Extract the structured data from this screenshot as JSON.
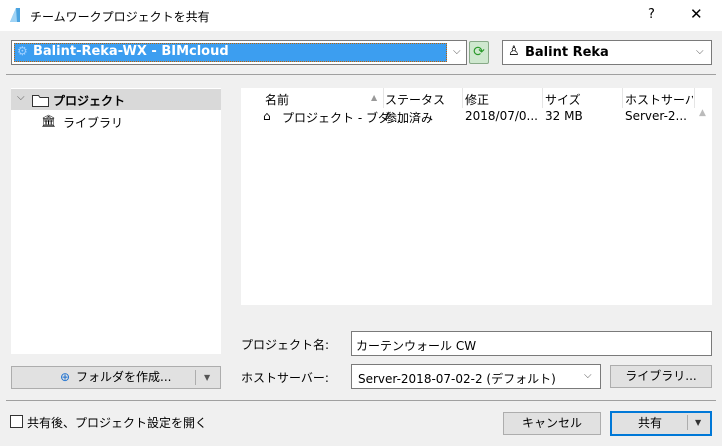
{
  "window": {
    "title": "チームワークプロジェクトを共有",
    "help": "?",
    "close": "✕"
  },
  "server_select": {
    "value": "Balint-Reka-WX - BIMcloud"
  },
  "user_select": {
    "value": "Balint Reka"
  },
  "tree": [
    {
      "label": "プロジェクト"
    },
    {
      "label": "ライブラリ"
    }
  ],
  "table": {
    "columns": [
      "名前",
      "ステータス",
      "修正",
      "サイズ",
      "ホストサーバ..."
    ],
    "rows": [
      {
        "name": "プロジェクト - ブダ...",
        "status": "参加済み",
        "modified": "2018/07/0...",
        "size": "32 MB",
        "host": "Server-2..."
      }
    ]
  },
  "form": {
    "project_name_label": "プロジェクト名:",
    "project_name_value": "カーテンウォール CW",
    "host_label": "ホストサーバー:",
    "host_value": "Server-2018-07-02-2 (デフォルト)",
    "library_button": "ライブラリ..."
  },
  "create_folder_button": "フォルダを作成...",
  "open_settings_checkbox": {
    "label": "共有後、プロジェクト設定を開く",
    "checked": false
  },
  "cancel_button": "キャンセル",
  "share_button": "共有",
  "colors": {
    "selection": "#3c9ef0",
    "accent": "#0078d7"
  }
}
